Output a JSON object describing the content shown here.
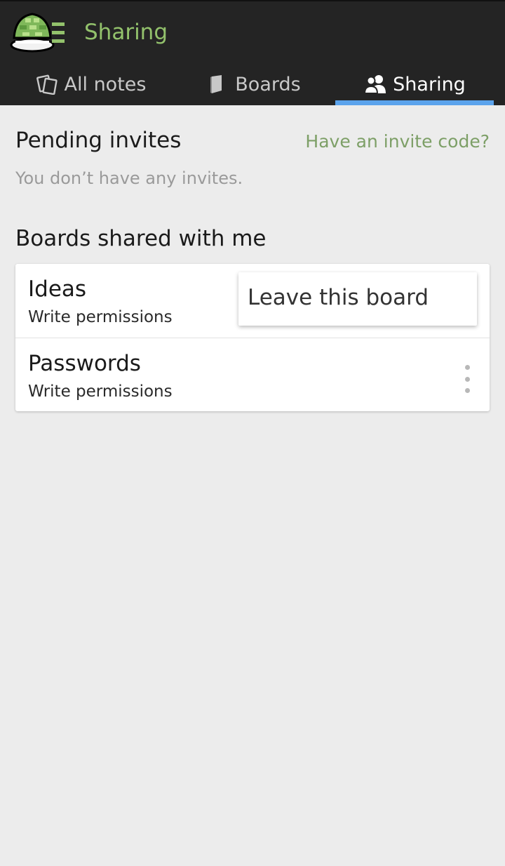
{
  "app_bar": {
    "title": "Sharing",
    "logo_icon": "turtle-shell-logo-icon"
  },
  "tabs": [
    {
      "label": "All notes",
      "icon": "notes-icon",
      "active": false
    },
    {
      "label": "Boards",
      "icon": "book-icon",
      "active": false
    },
    {
      "label": "Sharing",
      "icon": "people-icon",
      "active": true
    }
  ],
  "pending": {
    "title": "Pending invites",
    "invite_link": "Have an invite code?",
    "empty_text": "You don’t have any invites."
  },
  "shared": {
    "title": "Boards shared with me",
    "boards": [
      {
        "name": "Ideas",
        "permissions": "Write permissions"
      },
      {
        "name": "Passwords",
        "permissions": "Write permissions"
      }
    ]
  },
  "popup": {
    "leave_label": "Leave this board"
  },
  "colors": {
    "app_bar_bg": "#242424",
    "title_green": "#93c26c",
    "tab_indicator": "#5ba3ec",
    "link_green": "#7d9f67",
    "page_bg": "#ececec"
  }
}
